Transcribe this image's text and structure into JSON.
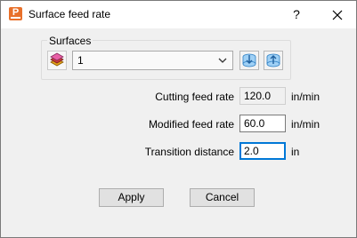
{
  "window": {
    "title": "Surface feed rate",
    "help_label": "?",
    "app_icon_letter": "P"
  },
  "surfaces": {
    "group_label": "Surfaces",
    "selected": "1",
    "icons": [
      "layers-icon",
      "chevron-down-icon",
      "arrow-down-icon",
      "arrow-up-icon"
    ]
  },
  "fields": {
    "cutting": {
      "label": "Cutting feed rate",
      "value": "120.0",
      "unit": "in/min"
    },
    "modified": {
      "label": "Modified feed rate",
      "value": "60.0",
      "unit": "in/min"
    },
    "transition": {
      "label": "Transition distance",
      "value": "2.0",
      "unit": "in"
    }
  },
  "buttons": {
    "apply": "Apply",
    "cancel": "Cancel"
  },
  "colors": {
    "accent": "#0078d7",
    "app_icon": "#e8702a",
    "arrow_blue": "#3c8fd6"
  }
}
